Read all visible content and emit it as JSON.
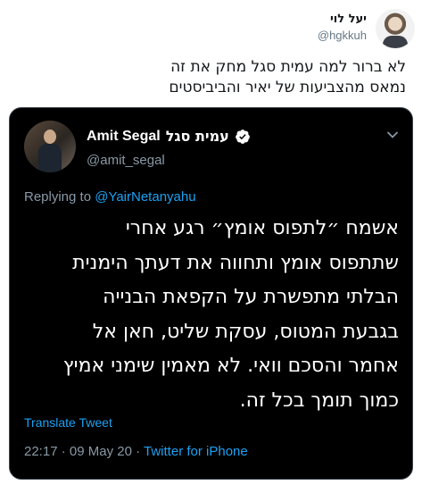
{
  "outer_tweet": {
    "author_name": "יעל לוי",
    "author_handle": "@hgkkuh",
    "text_line_1": "לא ברור למה עמית סגל מחק את זה",
    "text_line_2": "נמאס מהצביעות של יאיר והביביסטים"
  },
  "quoted_tweet": {
    "author_name": "Amit Segal",
    "author_name_hebrew": "עמית סגל",
    "author_handle": "@amit_segal",
    "verified_icon": "verified-badge-icon",
    "menu_icon": "chevron-down-icon",
    "reply_prefix": "Replying to",
    "reply_mention": "@YairNetanyahu",
    "text_lines": [
      "אשמח ״לתפוס אומץ״ רגע אחרי",
      "שתתפוס אומץ ותחווה את דעתך הימנית",
      "הבלתי מתפשרת על הקפאת הבנייה",
      "בגבעת המטוס, עסקת שליט, חאן אל",
      "אחמר והסכם וואי. לא מאמין שימני אמיץ",
      "כמוך תומך בכל זה."
    ],
    "translate_label": "Translate Tweet",
    "time": "22:17",
    "separator": "·",
    "date": "09 May 20",
    "source": "Twitter for iPhone"
  },
  "colors": {
    "quote_background": "#000000",
    "link_blue": "#1da1f2",
    "muted_gray": "#8899a6"
  }
}
